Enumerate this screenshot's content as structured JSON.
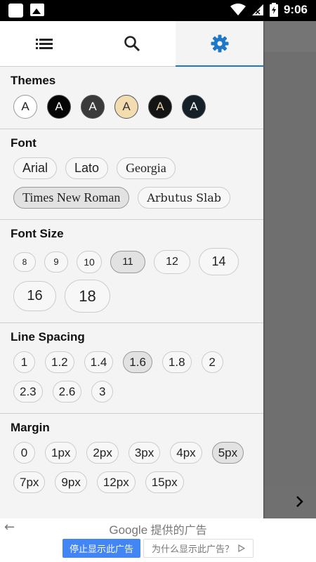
{
  "status_bar": {
    "time": "9:06"
  },
  "tabs": [
    {
      "icon": "list-icon",
      "active": false
    },
    {
      "icon": "search-icon",
      "active": false
    },
    {
      "icon": "gear-icon",
      "active": true
    }
  ],
  "themes": {
    "title": "Themes",
    "items": [
      {
        "label": "A",
        "bg": "#ffffff",
        "fg": "#222222"
      },
      {
        "label": "A",
        "bg": "#050505",
        "fg": "#ffffff"
      },
      {
        "label": "A",
        "bg": "#3a3a3a",
        "fg": "#ffffff"
      },
      {
        "label": "A",
        "bg": "#f3dcb0",
        "fg": "#333333"
      },
      {
        "label": "A",
        "bg": "#141414",
        "fg": "#e8d2a8"
      },
      {
        "label": "A",
        "bg": "#152029",
        "fg": "#ffffff"
      }
    ]
  },
  "font": {
    "title": "Font",
    "items": [
      "Arial",
      "Lato",
      "Georgia",
      "Times New Roman",
      "Arbutus Slab"
    ],
    "selected": "Times New Roman"
  },
  "font_size": {
    "title": "Font Size",
    "items": [
      "8",
      "9",
      "10",
      "11",
      "12",
      "14",
      "16",
      "18"
    ],
    "selected": "11"
  },
  "line_spacing": {
    "title": "Line Spacing",
    "items": [
      "1",
      "1.2",
      "1.4",
      "1.6",
      "1.8",
      "2",
      "2.3",
      "2.6",
      "3"
    ],
    "selected": "1.6"
  },
  "margin": {
    "title": "Margin",
    "items": [
      "0",
      "1px",
      "2px",
      "3px",
      "4px",
      "5px",
      "7px",
      "9px",
      "12px",
      "15px"
    ],
    "selected": "5px"
  },
  "ad": {
    "brand": "Google",
    "brand_suffix": "提供的广告",
    "stop_label": "停止显示此广告",
    "why_label": "为什么显示此广告？"
  }
}
